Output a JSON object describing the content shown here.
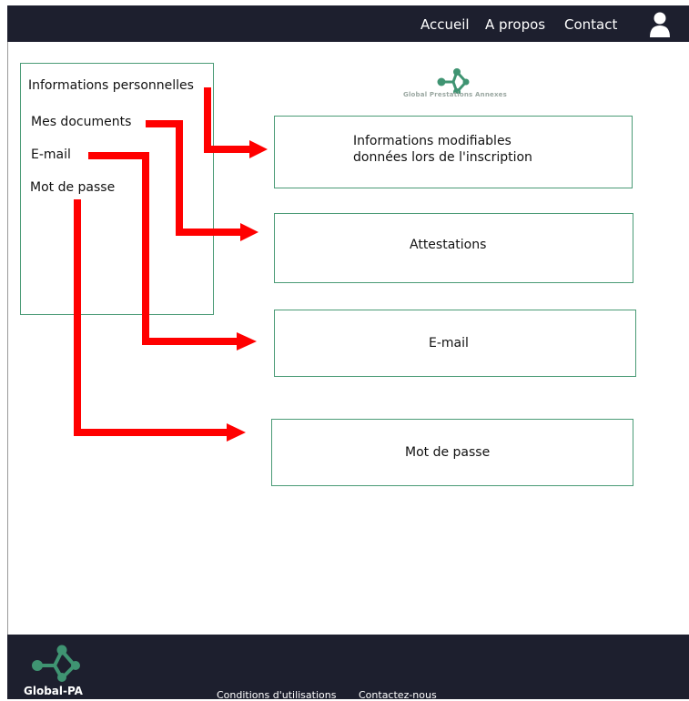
{
  "nav": {
    "links": [
      "Accueil",
      "A propos",
      "Contact"
    ],
    "user_icon": "user-icon"
  },
  "sidebar": {
    "items": [
      "Informations personnelles",
      "Mes documents",
      "E-mail",
      "Mot de passe"
    ]
  },
  "logo": {
    "tagline": "Global Prestations Annexes",
    "icon": "molecule-logo-icon"
  },
  "panels": {
    "info": [
      "Informations modifiables",
      "données lors de l'inscription"
    ],
    "attestations": "Attestations",
    "email": "E-mail",
    "password": "Mot de passe"
  },
  "footer": {
    "brand": "Global-PA",
    "links": [
      "Conditions d'utilisations",
      "Contactez-nous"
    ]
  },
  "colors": {
    "header_bg": "#1d1f2e",
    "footer_bg": "#1d1f2e",
    "accent_green": "#3f9472",
    "border_green": "#4a9b76",
    "arrow_red": "#ff0000"
  }
}
